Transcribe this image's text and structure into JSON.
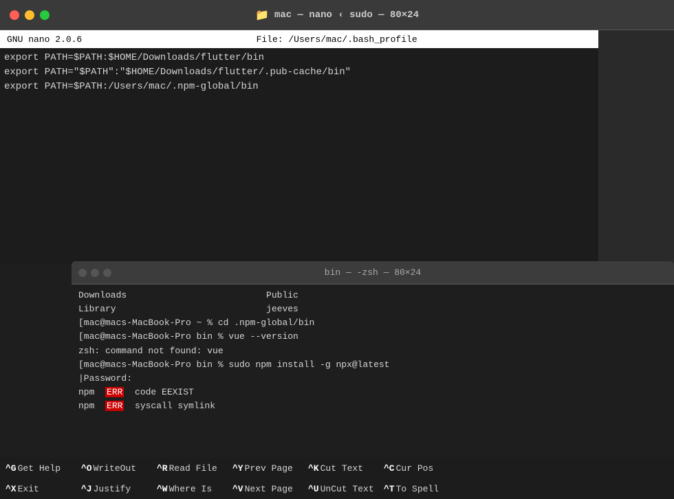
{
  "titleBar": {
    "title": "mac — nano ‹ sudo — 80×24",
    "folderIcon": "📁"
  },
  "nanoEditor": {
    "statusLeft": "GNU nano 2.0.6",
    "statusRight": "File: /Users/mac/.bash_profile",
    "lines": [
      "export PATH=$PATH:$HOME/Downloads/flutter/bin",
      "export PATH=\"$PATH\":\"$HOME/Downloads/flutter/.pub-cache/bin\"",
      "export PATH=$PATH:/Users/mac/.npm-global/bin"
    ]
  },
  "terminal": {
    "title": "bin — -zsh — 80×24",
    "lines": [
      "Downloads                          Public",
      "Library                            jeeves",
      "[mac@macs-MacBook-Pro ~ % cd .npm-global/bin",
      "[mac@macs-MacBook-Pro bin % vue --version",
      "zsh: command not found: vue",
      "[mac@macs-MacBook-Pro bin % sudo npm install -g npx@latest",
      "|Password:",
      "npm  ERR  code EEXIST",
      "npm  ERR  syscall symlink"
    ],
    "errorWord1": "ERR",
    "errorWord2": "ERR"
  },
  "shortcuts": {
    "row1": [
      {
        "key": "^G",
        "label": "Get Help"
      },
      {
        "key": "^O",
        "label": "WriteOut"
      },
      {
        "key": "^R",
        "label": "Read File"
      },
      {
        "key": "^Y",
        "label": "Prev Page"
      },
      {
        "key": "^K",
        "label": "Cut Text"
      },
      {
        "key": "^C",
        "label": "Cur Pos"
      }
    ],
    "row2": [
      {
        "key": "^X",
        "label": "Exit"
      },
      {
        "key": "^J",
        "label": "Justify"
      },
      {
        "key": "^W",
        "label": "Where Is"
      },
      {
        "key": "^V",
        "label": "Next Page"
      },
      {
        "key": "^U",
        "label": "UnCut Text"
      },
      {
        "key": "^T",
        "label": "To Spell"
      }
    ]
  }
}
